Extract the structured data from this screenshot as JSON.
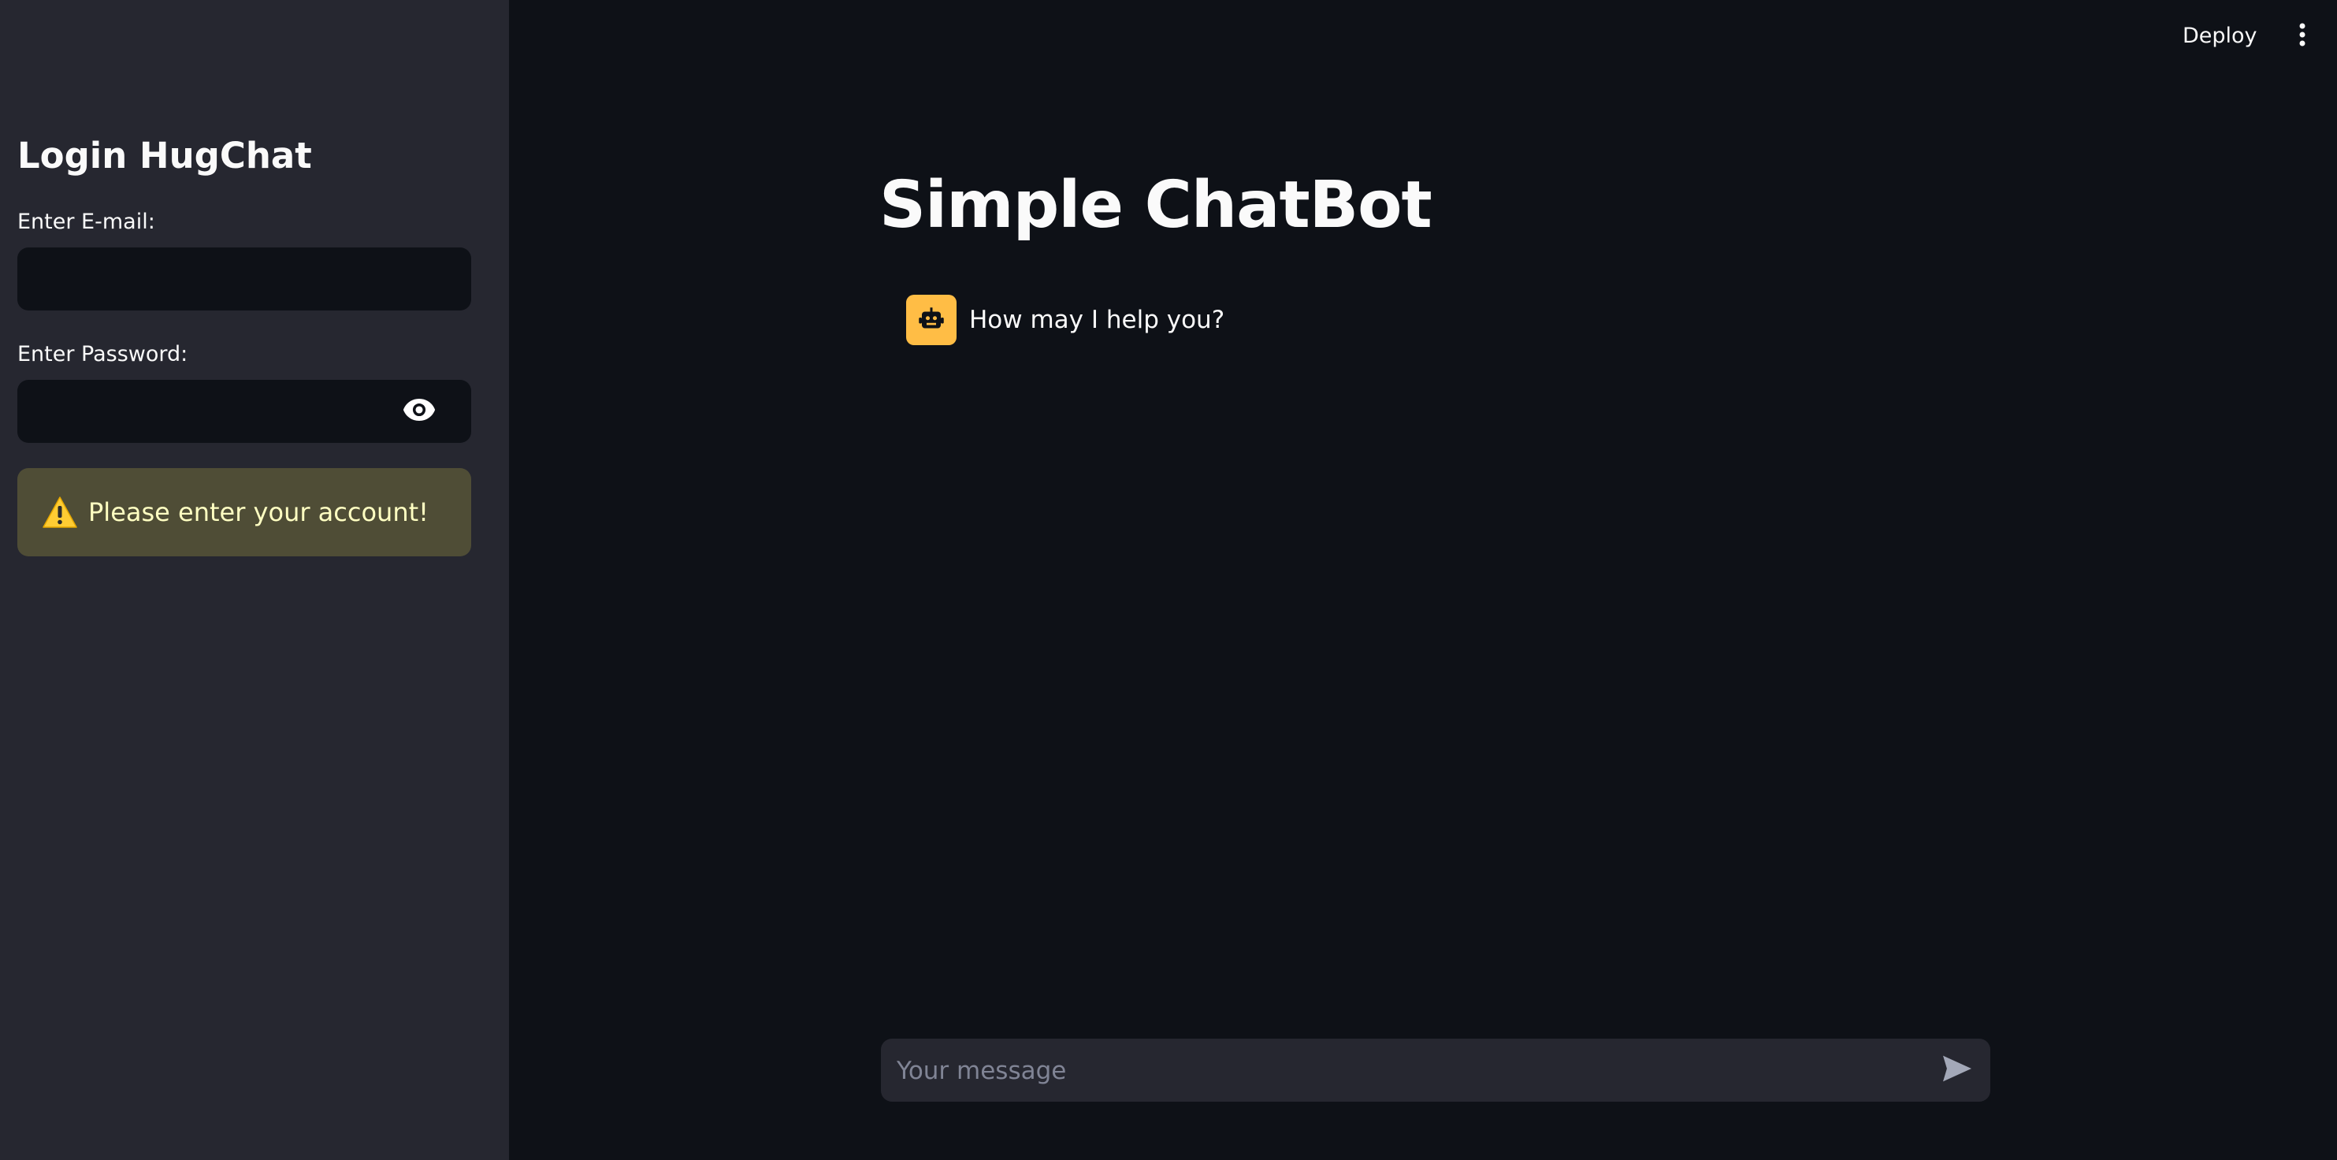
{
  "header": {
    "deploy_label": "Deploy",
    "menu_icon": "kebab-vertical-icon"
  },
  "sidebar": {
    "title": "Login HugChat",
    "email": {
      "label": "Enter E-mail:",
      "value": "",
      "placeholder": ""
    },
    "password": {
      "label": "Enter Password:",
      "value": "",
      "placeholder": "",
      "toggle_icon": "eye-icon"
    },
    "warning": {
      "icon": "warning-triangle-icon",
      "text": "Please enter your account!"
    }
  },
  "main": {
    "title": "Simple ChatBot",
    "messages": [
      {
        "role": "assistant",
        "avatar_icon": "robot-icon",
        "text": "How may I help you?"
      }
    ],
    "chat_input": {
      "placeholder": "Your message",
      "value": "",
      "send_icon": "send-icon"
    }
  },
  "colors": {
    "background": "#0e1117",
    "sidebar": "#262730",
    "warning_bg": "#4f4d36",
    "warning_text": "#ffffc2",
    "avatar": "#ffbd45"
  }
}
